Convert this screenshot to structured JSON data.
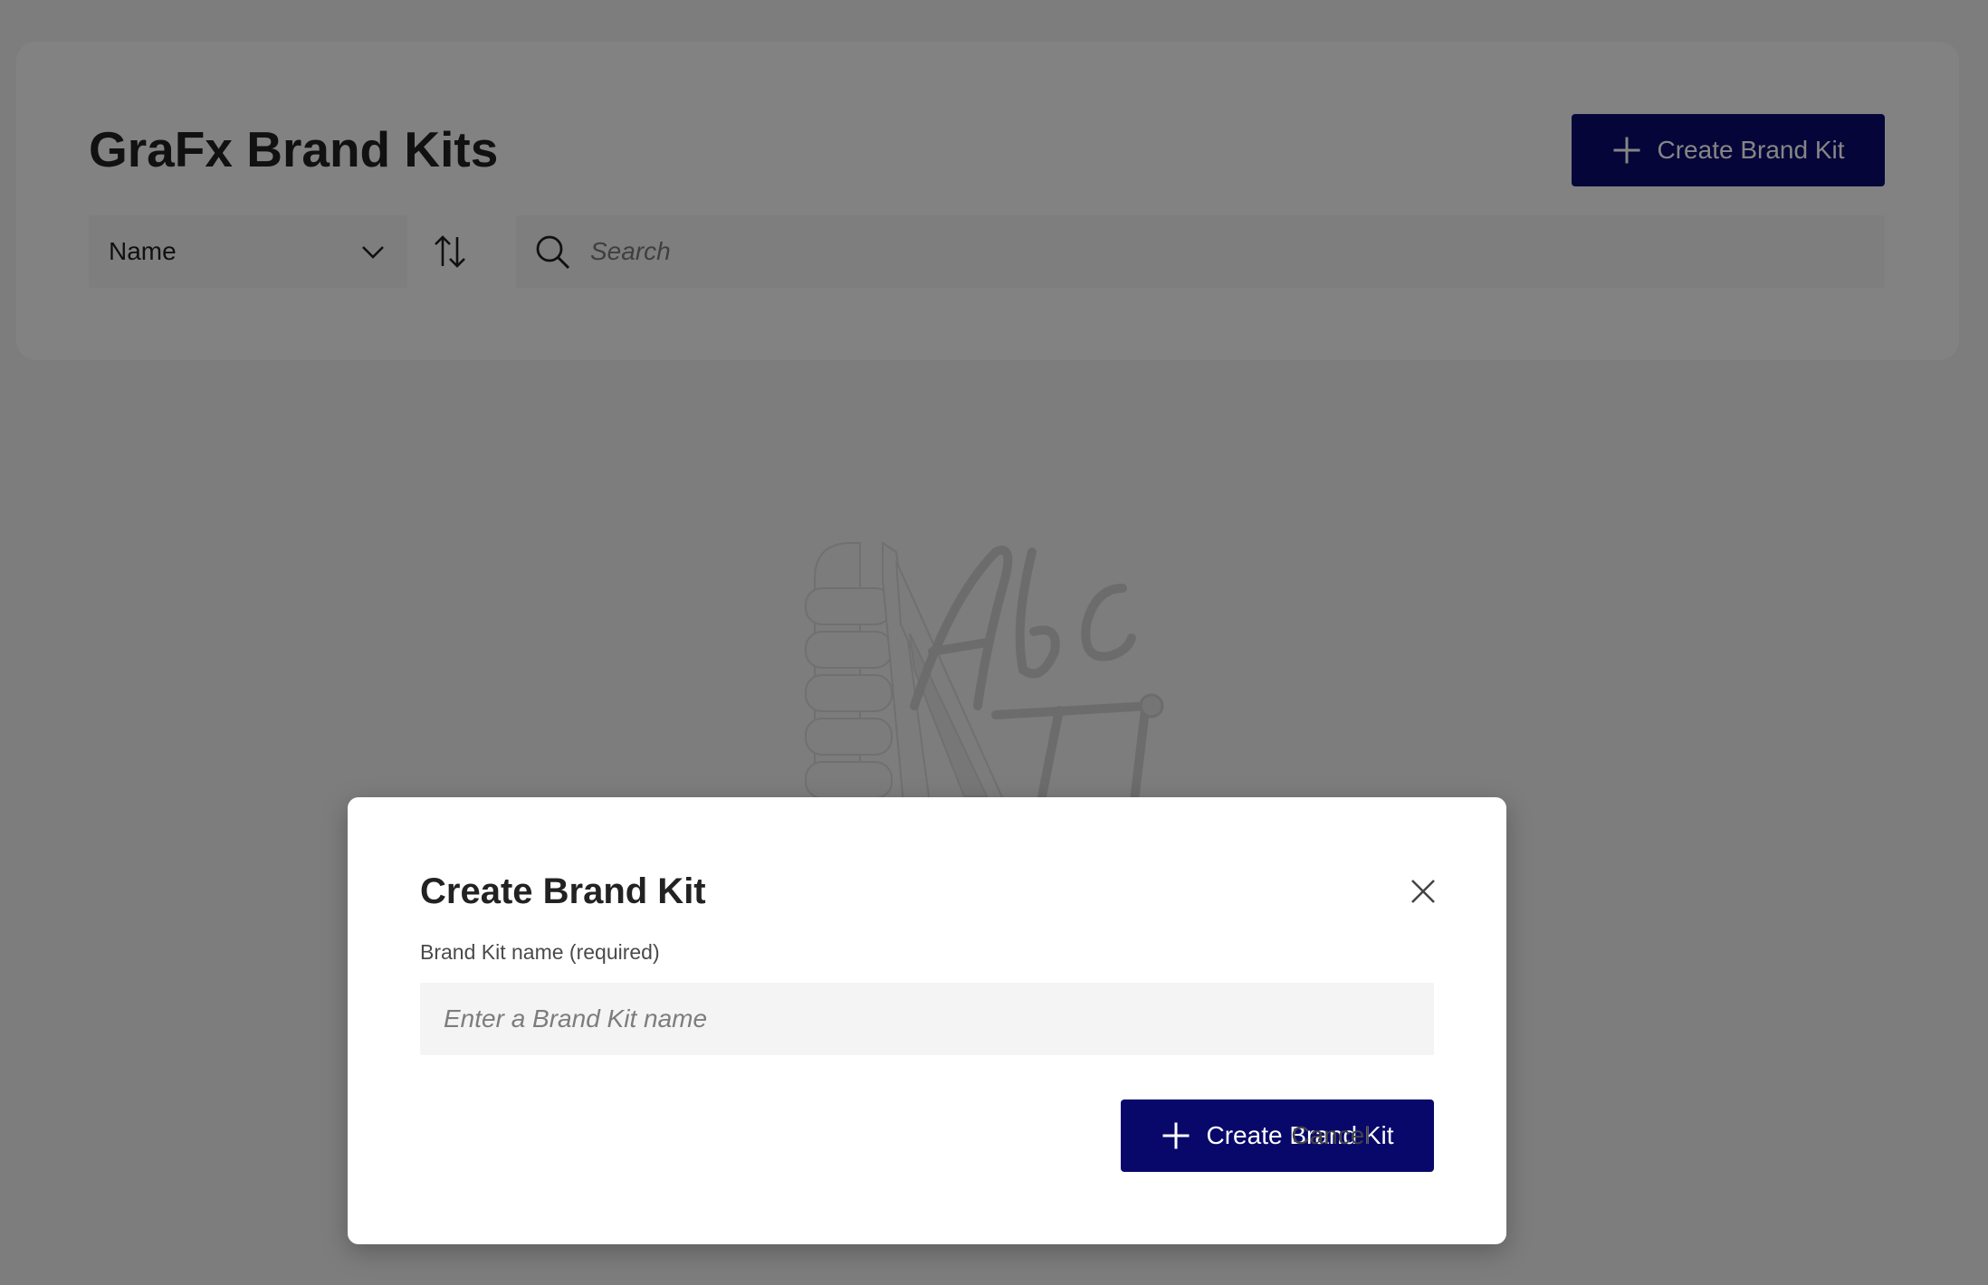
{
  "page": {
    "title": "GraFx Brand Kits",
    "create_button_label": "Create Brand Kit",
    "create_button_icon": "plus-icon",
    "sort": {
      "selected": "Name",
      "dropdown_icon": "chevron-down-icon",
      "direction_icon": "sort-arrows-icon"
    },
    "search": {
      "placeholder": "Search",
      "value": "",
      "icon": "search-icon"
    },
    "empty_state": {
      "illustration": "brand-kit-illustration"
    }
  },
  "modal": {
    "title": "Create Brand Kit",
    "close_icon": "close-icon",
    "field_label": "Brand Kit name (required)",
    "input_placeholder": "Enter a Brand Kit name",
    "input_value": "",
    "cancel_label": "Cancel",
    "create_label": "Create Brand Kit",
    "create_icon": "plus-icon"
  },
  "colors": {
    "primary_button": "#08086b",
    "overlay": "rgba(0,0,0,0.48)",
    "input_background": "#f4f4f4"
  }
}
